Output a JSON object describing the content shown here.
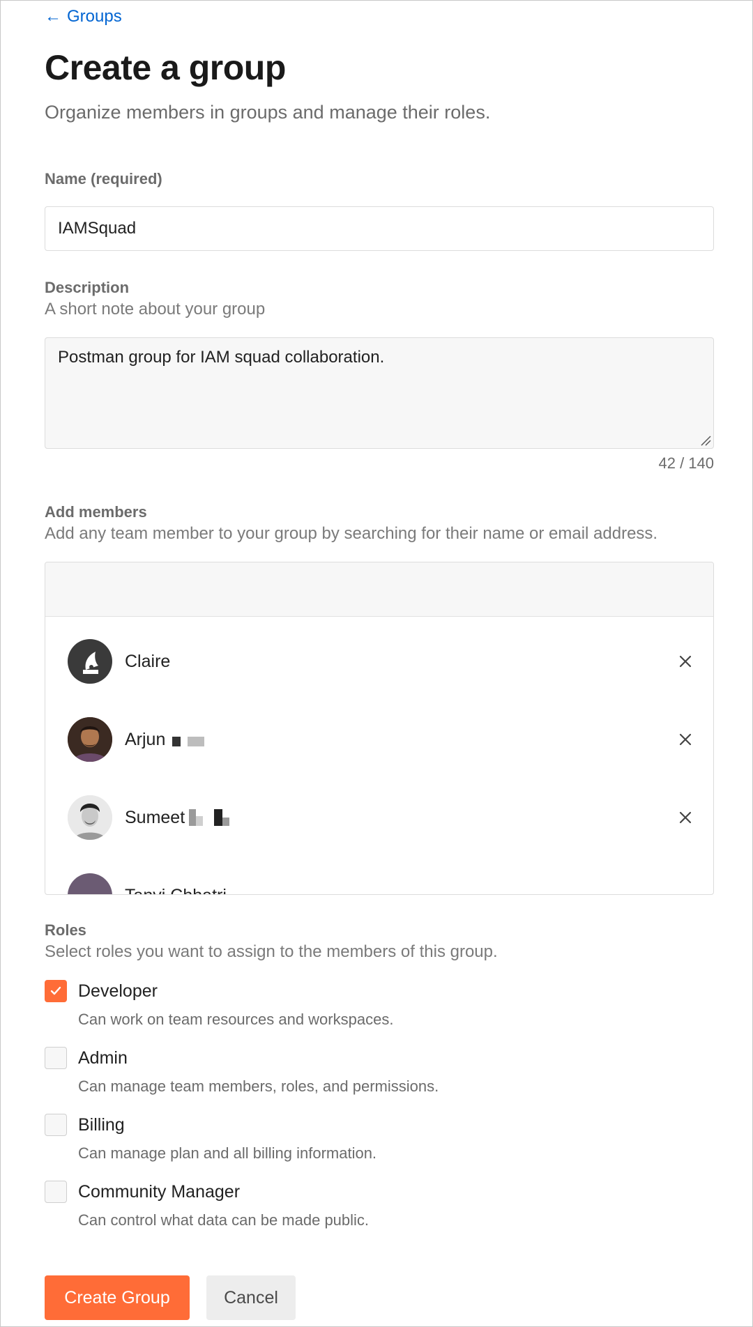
{
  "breadcrumb": {
    "back_label": "Groups"
  },
  "header": {
    "title": "Create a group",
    "subtitle": "Organize members in groups and manage their roles."
  },
  "form": {
    "name": {
      "label": "Name (required)",
      "value": "IAMSquad"
    },
    "description": {
      "label": "Description",
      "hint": "A short note about your group",
      "value": "Postman group for IAM squad collaboration.",
      "char_count": "42 / 140"
    },
    "members": {
      "label": "Add members",
      "hint": "Add any team member to your group by searching for their name or email address.",
      "search_value": "",
      "list": [
        {
          "name": "Claire",
          "avatar": "gramophone-avatar",
          "avatar_color": "#3a3a3a"
        },
        {
          "name": "Arjun",
          "avatar": "photo-avatar",
          "avatar_color": "#5a3a2a"
        },
        {
          "name": "Sumeet",
          "avatar": "photo-avatar",
          "avatar_color": "#d8d8d8"
        },
        {
          "name": "Tanvi Chhatri",
          "avatar": "photo-avatar",
          "avatar_color": "#6b5b73"
        }
      ]
    },
    "roles": {
      "label": "Roles",
      "hint": "Select roles you want to assign to the members of this group.",
      "items": [
        {
          "name": "Developer",
          "description": "Can work on team resources and workspaces.",
          "checked": true
        },
        {
          "name": "Admin",
          "description": "Can manage team members, roles, and permissions.",
          "checked": false
        },
        {
          "name": "Billing",
          "description": "Can manage plan and all billing information.",
          "checked": false
        },
        {
          "name": "Community Manager",
          "description": "Can control what data can be made public.",
          "checked": false
        }
      ]
    }
  },
  "actions": {
    "create_label": "Create Group",
    "cancel_label": "Cancel"
  },
  "colors": {
    "accent": "#ff6c37",
    "link": "#0265d2"
  }
}
